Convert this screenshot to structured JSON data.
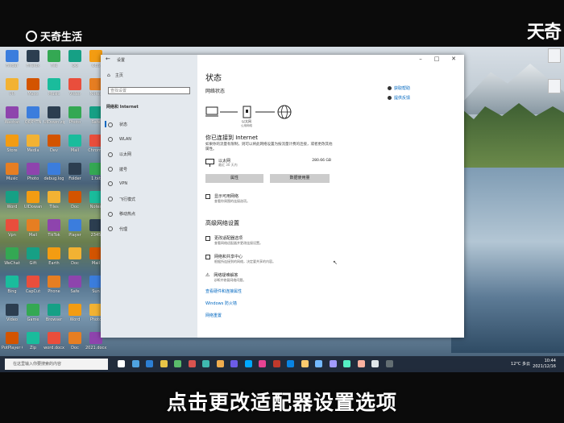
{
  "watermark": {
    "brand": "天奇生活",
    "brand_right": "天奇"
  },
  "caption": "点击更改适配器设置选项",
  "desktop": {
    "icons": [
      {
        "label": "Finder"
      },
      {
        "label": "Firefox"
      },
      {
        "label": "Tile"
      },
      {
        "label": "QQ"
      },
      {
        "label": "OBS"
      },
      {
        "label": "PR"
      },
      {
        "label": "Maxx"
      },
      {
        "label": "Music"
      },
      {
        "label": "Video"
      },
      {
        "label": "Notes"
      },
      {
        "label": "Wechat"
      },
      {
        "label": "QQPYTN"
      },
      {
        "label": "UIDown.zip"
      },
      {
        "label": "Photo"
      },
      {
        "label": "Safe"
      },
      {
        "label": "Store"
      },
      {
        "label": "Media"
      },
      {
        "label": "Dev"
      },
      {
        "label": "Mail"
      },
      {
        "label": "Chrome"
      },
      {
        "label": "Music"
      },
      {
        "label": "Photo"
      },
      {
        "label": "debug.log"
      },
      {
        "label": "Folder"
      },
      {
        "label": "1.txt"
      },
      {
        "label": "Word"
      },
      {
        "label": "UIDowan"
      },
      {
        "label": "Tiles"
      },
      {
        "label": "Doc"
      },
      {
        "label": "Notes"
      },
      {
        "label": "Vpn"
      },
      {
        "label": "Mail"
      },
      {
        "label": "TikTok"
      },
      {
        "label": "Player"
      },
      {
        "label": "2345"
      },
      {
        "label": "WeChat"
      },
      {
        "label": "Gift"
      },
      {
        "label": "Earth"
      },
      {
        "label": "Doc"
      },
      {
        "label": "Mail"
      },
      {
        "label": "Bing"
      },
      {
        "label": "CapCut"
      },
      {
        "label": "Phone"
      },
      {
        "label": "Safe"
      },
      {
        "label": "Sun"
      },
      {
        "label": "Video"
      },
      {
        "label": "Game"
      },
      {
        "label": "Browser"
      },
      {
        "label": "Word"
      },
      {
        "label": "Photo"
      },
      {
        "label": "PotPlayer 64 bit"
      },
      {
        "label": "Zip"
      },
      {
        "label": "word.docx"
      },
      {
        "label": "Doc"
      },
      {
        "label": "2021.docx"
      }
    ]
  },
  "settings": {
    "window_title": "设置",
    "home": "主页",
    "search_placeholder": "查找设置",
    "section": "网络和 Internet",
    "nav": [
      {
        "label": "状态",
        "active": true
      },
      {
        "label": "WLAN",
        "active": false
      },
      {
        "label": "以太网",
        "active": false
      },
      {
        "label": "拨号",
        "active": false
      },
      {
        "label": "VPN",
        "active": false
      },
      {
        "label": "飞行模式",
        "active": false
      },
      {
        "label": "移动热点",
        "active": false
      },
      {
        "label": "代理",
        "active": false
      }
    ],
    "page_title": "状态",
    "network_status": "网络状态",
    "diagram": {
      "eth_label": "以太网",
      "eth_sub": "公用网络"
    },
    "connected_title": "你已连接到 Internet",
    "connected_desc": "如果你的流量有限制，则可以将此网络设置为按流量计费的连接，或者更改其他属性。",
    "ethernet": {
      "name": "以太网",
      "sub": "最近 30 天内",
      "usage": "280.66 GB"
    },
    "buttons": {
      "properties": "属性",
      "data_usage": "数据使用量"
    },
    "show_networks": {
      "title": "显示可用网络",
      "desc": "查看你周围的连接选项。"
    },
    "advanced_title": "高级网络设置",
    "advanced": [
      {
        "title": "更改适配器选项",
        "desc": "查看网络适配器并更改连接设置。"
      },
      {
        "title": "网络和共享中心",
        "desc": "根据所连接到的网络，决定要共享的内容。"
      },
      {
        "title": "网络疑难解答",
        "desc": "诊断并修复网络问题。"
      }
    ],
    "links": [
      "查看硬件和连接属性",
      "Windows 防火墙",
      "网络重置"
    ],
    "related": [
      "获取帮助",
      "提供反馈"
    ]
  },
  "taskbar": {
    "search": "在这里输入你要搜索的内容",
    "weather": "12°C 多云",
    "time": "10:44",
    "date": "2021/12/16"
  },
  "colors": {
    "accent": "#0067c0"
  }
}
